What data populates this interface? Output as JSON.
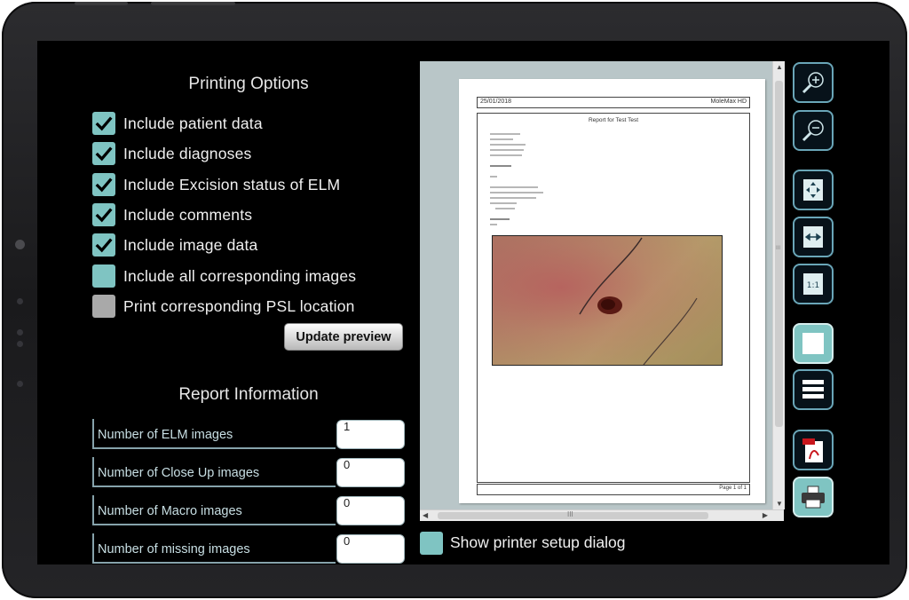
{
  "printing_options": {
    "title": "Printing Options",
    "options": [
      {
        "label": "Include patient data",
        "checked": true
      },
      {
        "label": "Include diagnoses",
        "checked": true
      },
      {
        "label": "Include Excision status of ELM",
        "checked": true
      },
      {
        "label": "Include comments",
        "checked": true
      },
      {
        "label": "Include image data",
        "checked": true
      },
      {
        "label": "Include all corresponding images",
        "checked": false
      },
      {
        "label": "Print corresponding PSL location",
        "checked": false,
        "disabled": true
      }
    ],
    "update_button": "Update preview"
  },
  "report_information": {
    "title": "Report Information",
    "rows": [
      {
        "label": "Number of ELM images",
        "value": "1"
      },
      {
        "label": "Number of Close Up images",
        "value": "0"
      },
      {
        "label": "Number of Macro images",
        "value": "0"
      },
      {
        "label": "Number of missing images",
        "value": "0"
      }
    ]
  },
  "preview": {
    "date": "25/01/2018",
    "app_name": "MoleMax HD",
    "report_title": "Report for Test Test",
    "page_label": "Page 1 of 1",
    "hscroll_grip": "III",
    "vscroll_grip": "III"
  },
  "toolbar": [
    "zoom-in-icon",
    "zoom-out-icon",
    "fit-page-icon",
    "fit-width-icon",
    "actual-size-icon",
    "single-page-icon",
    "multi-page-icon",
    "pdf-icon",
    "printer-icon"
  ],
  "printer_setup": {
    "label": "Show printer setup dialog",
    "checked": false
  },
  "colors": {
    "accent": "#7fc4c2",
    "panel_bg": "#000000",
    "border": "#6aa6b8"
  }
}
